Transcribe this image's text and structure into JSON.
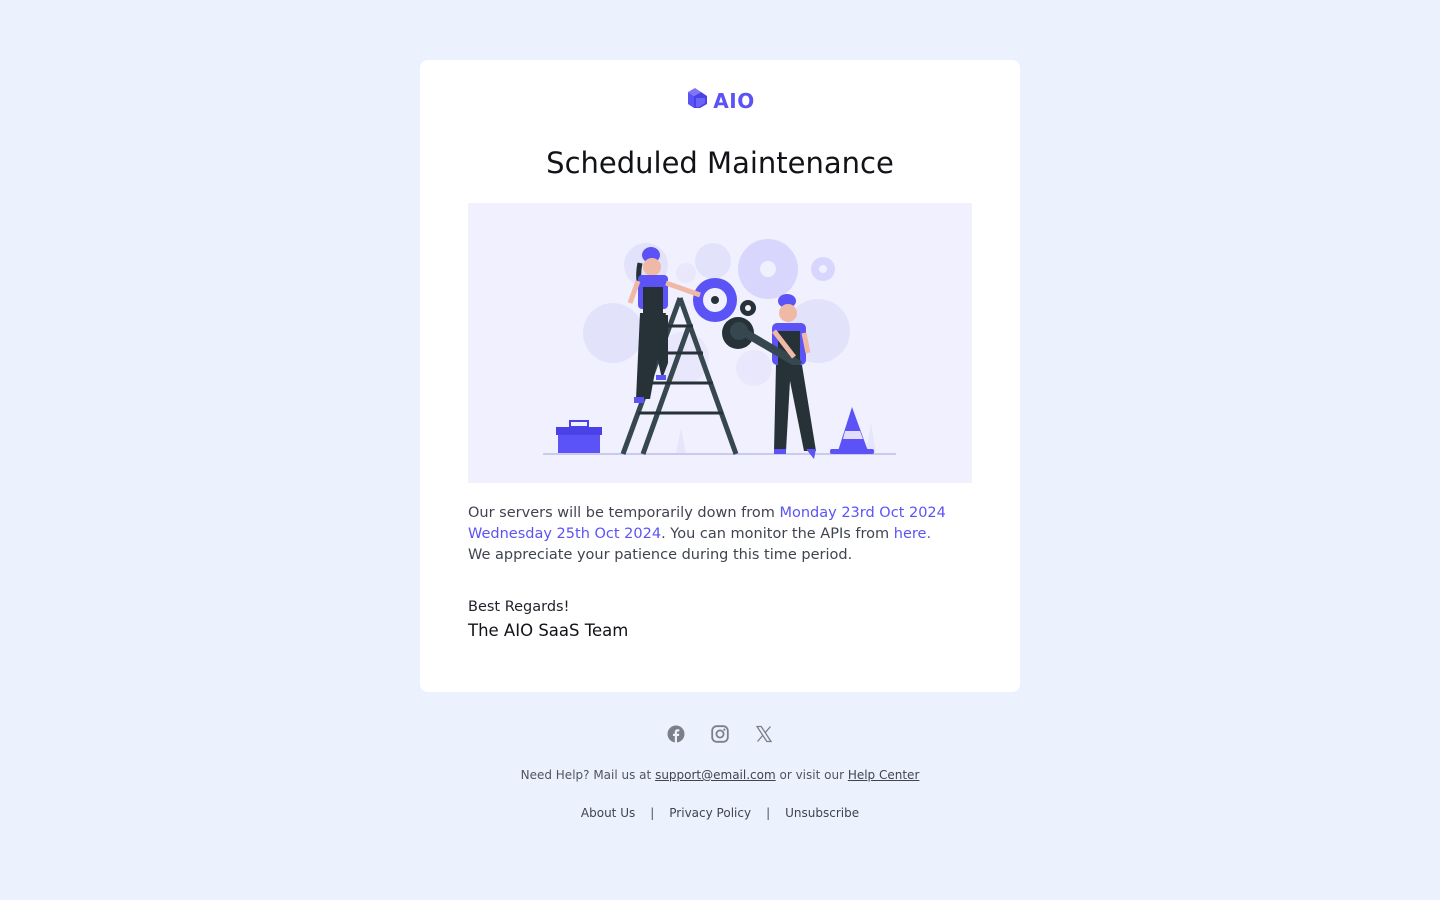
{
  "brand": {
    "name": "AIO",
    "logo_icon": "cube-logo-icon",
    "accent_color": "#5b53f5"
  },
  "email": {
    "title": "Scheduled Maintenance",
    "hero_image": "maintenance-illustration",
    "message": {
      "intro": "Our servers will be temporarily down from ",
      "start_date": "Monday 23rd Oct 2024",
      "end_date": "Wednesday 25th Oct 2024",
      "monitor_text": ". You can monitor the APIs from ",
      "monitor_link": "here.",
      "closing": "We appreciate your patience during this time period."
    },
    "regards": "Best Regards!",
    "signature": "The AIO SaaS Team"
  },
  "footer": {
    "social": [
      {
        "icon": "facebook-icon"
      },
      {
        "icon": "instagram-icon"
      },
      {
        "icon": "x-twitter-icon"
      }
    ],
    "help_prefix": "Need Help? Mail us at ",
    "support_email": "support@email.com",
    "help_middle": " or visit our ",
    "help_center": "Help Center",
    "links": {
      "about": "About Us",
      "privacy": "Privacy Policy",
      "unsubscribe": "Unsubscribe",
      "separator": "|"
    }
  }
}
